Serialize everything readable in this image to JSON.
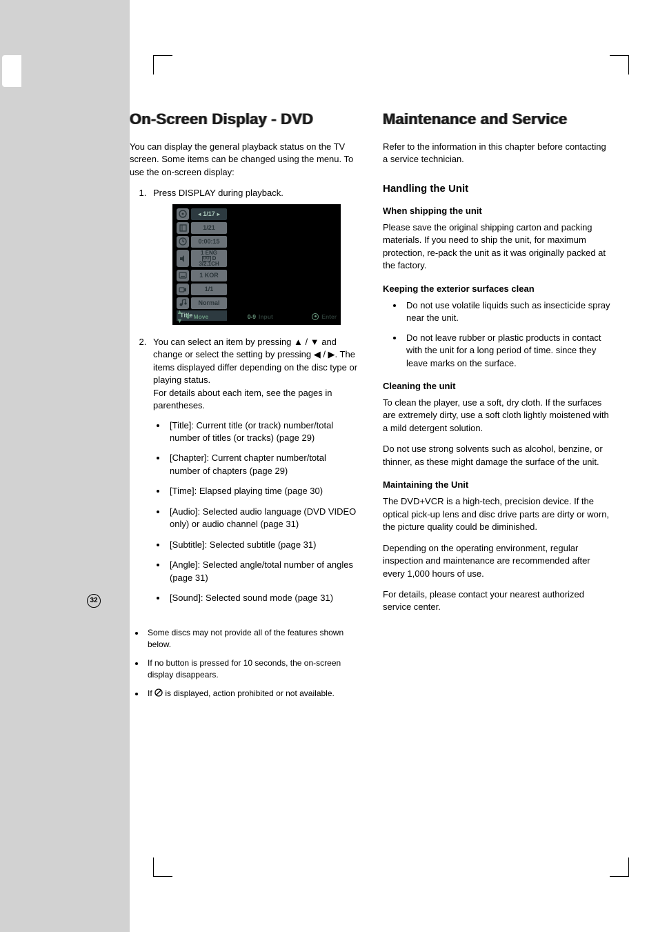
{
  "page_number": "32",
  "left": {
    "heading": "On-Screen Display - DVD",
    "intro": "You can display the general playback status on the TV screen. Some items can be changed using the menu. To use the on-screen display:",
    "step1": "Press DISPLAY during playback.",
    "osd": {
      "title_value": "1/17",
      "chapter_value": "1/21",
      "time_value": "0:00:15",
      "audio_top": "1    ENG",
      "audio_mid": "D",
      "audio_bot": "3/2.1CH",
      "subtitle_value": "1 KOR",
      "angle_value": "1/1",
      "sound_value": "Normal",
      "section_label": "Title",
      "footer_move": "Move",
      "footer_input_num": "0-9",
      "footer_input": "Input",
      "footer_enter": "Enter"
    },
    "step2a": "You can select an item by pressing ",
    "step2b": " and change or select the setting by pressing ",
    "step2c": ". The items displayed differ depending on the disc type or playing status.",
    "step2d": "For details about each item, see the pages in parentheses.",
    "items": {
      "title": "[Title]: Current title (or track) number/total number of titles (or tracks) (page 29)",
      "chapter": "[Chapter]: Current chapter number/total number of chapters (page 29)",
      "time": "[Time]: Elapsed playing time (page 30)",
      "audio": "[Audio]: Selected audio language (DVD VIDEO only) or audio channel (page 31)",
      "subtitle": "[Subtitle]: Selected subtitle (page 31)",
      "angle": "[Angle]: Selected angle/total number of angles (page 31)",
      "sound": "[Sound]: Selected sound mode (page 31)"
    },
    "notes": {
      "n1": "Some discs may not provide all of the features shown below.",
      "n2": "If no button is pressed for 10 seconds, the on-screen display disappears.",
      "n3a": "If ",
      "n3b": " is displayed, action prohibited or not available."
    }
  },
  "right": {
    "heading": "Maintenance and Service",
    "intro": "Refer to the information in this chapter before contacting a service technician.",
    "h2_handling": "Handling the Unit",
    "h3_shipping": "When shipping the unit",
    "p_shipping": "Please save the original shipping carton and packing materials. If you need to ship the unit, for maximum protection, re-pack the unit as it was originally packed at the factory.",
    "h3_exterior": "Keeping the exterior surfaces clean",
    "ext1": "Do not use volatile liquids such as insecticide spray near the unit.",
    "ext2": "Do not leave rubber or plastic products in contact with the unit for a long period of time. since they leave marks on the surface.",
    "h3_cleaning": "Cleaning the unit",
    "p_clean1": "To clean the player, use a soft, dry cloth. If the surfaces are extremely dirty, use a soft cloth lightly moistened with a mild detergent solution.",
    "p_clean2": "Do not use strong solvents such as alcohol, benzine, or thinner, as these might damage the surface of the unit.",
    "h3_maintain": "Maintaining the Unit",
    "p_maint1": "The DVD+VCR is a high-tech, precision device. If the optical pick-up lens and disc drive parts are dirty or worn, the picture quality could be diminished.",
    "p_maint2": "Depending on the operating environment, regular inspection and maintenance are recommended after every 1,000 hours of use.",
    "p_maint3": "For details, please contact your nearest authorized service center."
  }
}
